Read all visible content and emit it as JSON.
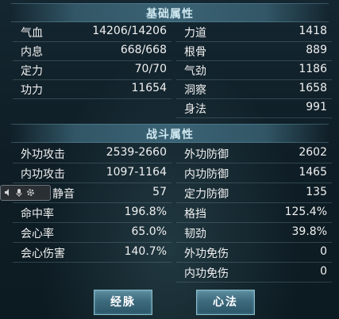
{
  "base": {
    "title": "基础属性",
    "left": [
      {
        "label": "气血",
        "value": "14206/14206"
      },
      {
        "label": "内息",
        "value": "668/668"
      },
      {
        "label": "定力",
        "value": "70/70"
      },
      {
        "label": "功力",
        "value": "11654"
      }
    ],
    "right": [
      {
        "label": "力道",
        "value": "1418"
      },
      {
        "label": "根骨",
        "value": "889"
      },
      {
        "label": "气劲",
        "value": "1186"
      },
      {
        "label": "洞察",
        "value": "1658"
      },
      {
        "label": "身法",
        "value": "991"
      }
    ]
  },
  "battle": {
    "title": "战斗属性",
    "left": [
      {
        "label": "外功攻击",
        "value": "2539-2660"
      },
      {
        "label": "内功攻击",
        "value": "1097-1164"
      },
      {
        "label": "静音",
        "value": "57"
      },
      {
        "label": "命中率",
        "value": "196.8%"
      },
      {
        "label": "会心率",
        "value": "65.0%"
      },
      {
        "label": "会心伤害",
        "value": "140.7%"
      }
    ],
    "right": [
      {
        "label": "外功防御",
        "value": "2602"
      },
      {
        "label": "内功防御",
        "value": "1465"
      },
      {
        "label": "定力防御",
        "value": "135"
      },
      {
        "label": "格挡",
        "value": "125.4%"
      },
      {
        "label": "韧劲",
        "value": "39.8%"
      },
      {
        "label": "外功免伤",
        "value": "0"
      },
      {
        "label": "内功免伤",
        "value": "0"
      }
    ]
  },
  "buttons": {
    "meridian": "经脉",
    "mind_method": "心法"
  },
  "icons": [
    "speaker-icon",
    "mic-icon",
    "gear-icon"
  ]
}
